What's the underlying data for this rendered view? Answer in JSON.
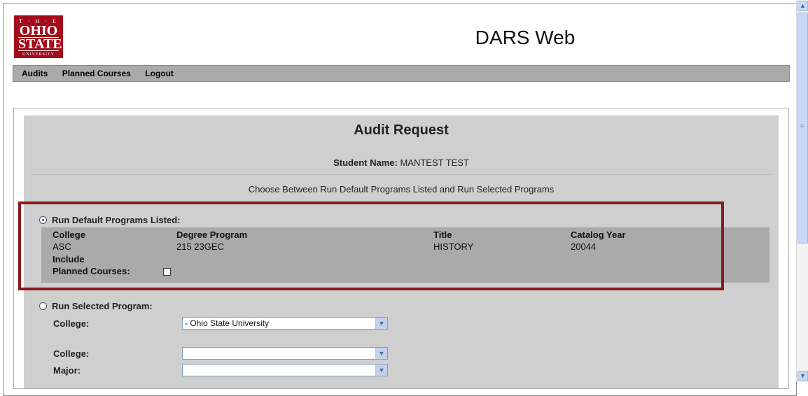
{
  "logo": {
    "line_the": "T · H · E",
    "line1": "OHIO",
    "line2": "STATE",
    "line_uni": "UNIVERSITY"
  },
  "app_title": "DARS Web",
  "menu": [
    "Audits",
    "Planned Courses",
    "Logout"
  ],
  "panel": {
    "title": "Audit Request",
    "student_label": "Student Name:",
    "student_value": "MANTEST TEST",
    "instruction": "Choose Between Run Default Programs Listed and Run Selected Programs"
  },
  "default_option": {
    "label": "Run Default Programs Listed:",
    "checked": true,
    "columns": [
      "College",
      "Degree Program",
      "Title",
      "Catalog Year"
    ],
    "row": [
      "ASC",
      "215 23GEC",
      "HISTORY",
      "20044"
    ],
    "include_label": "Include",
    "planned_label": "Planned Courses:",
    "planned_checked": false
  },
  "selected_option": {
    "label": "Run Selected Program:",
    "checked": false,
    "fields": [
      {
        "label": "College:",
        "value": "- Ohio State University"
      },
      {
        "label": "College:",
        "value": ""
      },
      {
        "label": "Major:",
        "value": ""
      }
    ]
  },
  "colors": {
    "accent_box": "#8b1a1a",
    "logo_bg": "#a30a1b",
    "panel_bg": "#cfcfcf",
    "menubar_bg": "#aaaaaa"
  },
  "icons": {
    "dropdown": "chevron-down-icon",
    "scroll_up": "arrow-up-icon",
    "scroll_down": "arrow-down-icon"
  }
}
